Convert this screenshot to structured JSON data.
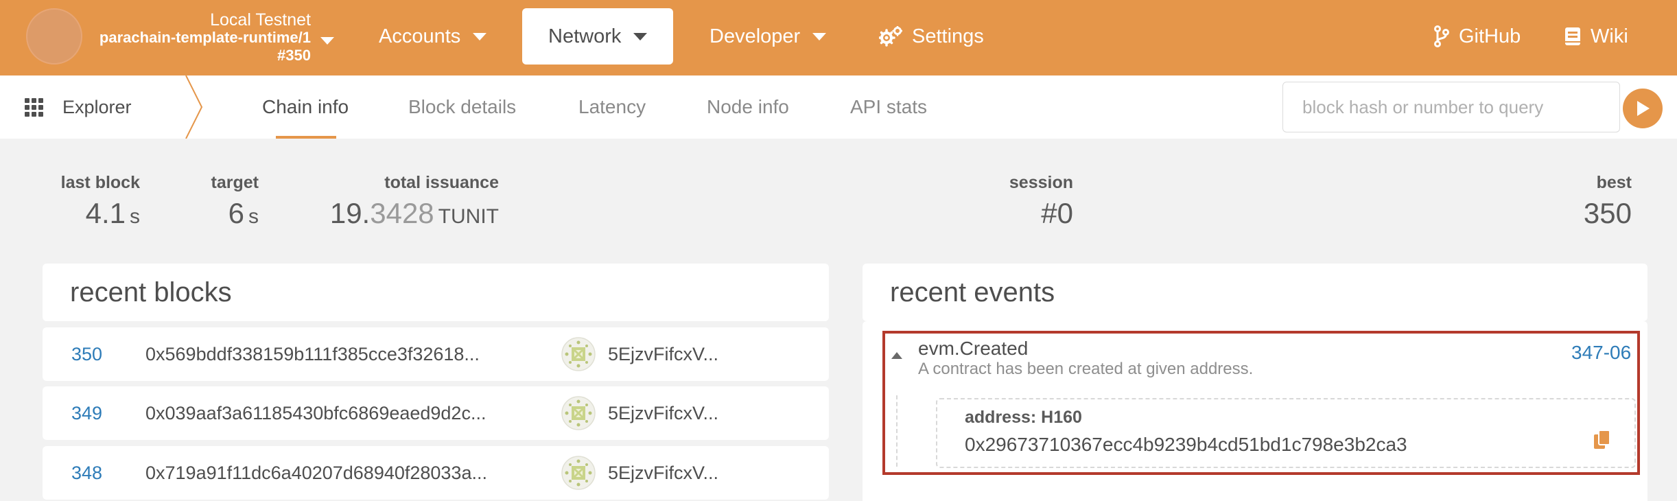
{
  "topbar": {
    "chain": {
      "name": "Local Testnet",
      "runtime": "parachain-template-runtime/1",
      "block": "#350"
    },
    "menu": {
      "accounts": "Accounts",
      "network": "Network",
      "developer": "Developer",
      "settings": "Settings",
      "github": "GitHub",
      "wiki": "Wiki"
    },
    "colors": {
      "accent": "#e5964a",
      "link": "#2e7cb8",
      "highlight": "#b43a2c"
    }
  },
  "subnav": {
    "crumb": "Explorer",
    "tabs": [
      "Chain info",
      "Block details",
      "Latency",
      "Node info",
      "API stats"
    ],
    "active_tab": "Chain info",
    "query_placeholder": "block hash or number to query"
  },
  "stats": {
    "last_block": {
      "label": "last block",
      "value": "4.1",
      "unit": "s"
    },
    "target": {
      "label": "target",
      "value": "6",
      "unit": "s"
    },
    "total_issuance": {
      "label": "total issuance",
      "value_main": "19.",
      "value_dim": "3428",
      "unit": "TUNIT"
    },
    "session": {
      "label": "session",
      "value": "#0"
    },
    "best": {
      "label": "best",
      "value": "350"
    }
  },
  "recent_blocks": {
    "title": "recent blocks",
    "rows": [
      {
        "number": "350",
        "hash": "0x569bddf338159b111f385cce3f32618...",
        "author": "5EjzvFifcxV..."
      },
      {
        "number": "349",
        "hash": "0x039aaf3a61185430bfc6869eaed9d2c...",
        "author": "5EjzvFifcxV..."
      },
      {
        "number": "348",
        "hash": "0x719a91f11dc6a40207d68940f28033a...",
        "author": "5EjzvFifcxV..."
      }
    ]
  },
  "recent_events": {
    "title": "recent events",
    "event": {
      "name": "evm.Created",
      "description": "A contract has been created at given address.",
      "link": "347-06",
      "param_label": "address: H160",
      "param_value": "0x29673710367ecc4b9239b4cd51bd1c798e3b2ca3"
    }
  },
  "icons": {
    "chain_selector": "chevron-down-icon",
    "settings": "gear-icon",
    "github": "github-branch-icon",
    "wiki": "book-icon",
    "explorer": "apps-grid-icon",
    "query": "play-icon",
    "event_toggle": "triangle-up-icon",
    "copy": "copy-icon"
  }
}
